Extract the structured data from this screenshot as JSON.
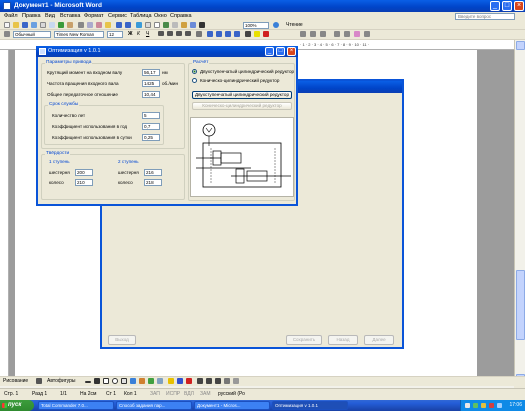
{
  "word": {
    "title": "Документ1 - Microsoft Word",
    "menu": [
      "Файл",
      "Правка",
      "Вид",
      "Вставка",
      "Формат",
      "Сервис",
      "Таблица",
      "Окно",
      "Справка"
    ],
    "help_placeholder": "Введите вопрос",
    "style_value": "Обычный",
    "font_value": "Times New Roman",
    "size_value": "12",
    "zoom_value": "100%",
    "read_label": "Чтение",
    "draw_label": "Рисование",
    "autoshapes_label": "Автофигуры",
    "status": [
      "Стр. 1",
      "Разд 1",
      "1/1",
      "На 2см",
      "Ст 1",
      "Кол 1",
      "ЗАП",
      "ИСПР",
      "ВДЛ",
      "ЗАМ",
      "русский (Ро"
    ]
  },
  "dialog": {
    "title": "Оптимизация v 1.0.1",
    "params_group": "Параметры привода",
    "torque_label": "Крутящий момент на входном валу",
    "torque_value": "56,17",
    "torque_unit": "нм",
    "speed_label": "Частота вращения входного вала",
    "speed_value": "1425",
    "speed_unit": "об./мин",
    "ratio_label": "Общее передаточное отношение",
    "ratio_value": "10,44",
    "service_group": "Срок службы",
    "years_label": "Количество лет",
    "years_value": "5",
    "kgod_label": "Коэффициент использования в год",
    "kgod_value": "0,7",
    "ksut_label": "Коэффициент использования в сутки",
    "ksut_value": "0,25",
    "hardness_group": "Твёрдости",
    "stage1_label": "1 ступень",
    "stage2_label": "2 ступень",
    "gear_label": "шестерня",
    "wheel_label": "колесо",
    "s1_gear": "200",
    "s1_wheel": "210",
    "s2_gear": "216",
    "s2_wheel": "218",
    "calc_group": "Расчёт",
    "radio1_label": "Двухступенчатый цилиндрический редуктор",
    "radio2_label": "Коническо-цилиндрический редуктор",
    "btn1_label": "Двухступенчатый цилиндрический редуктор",
    "btn2_label": "Коническо-цилиндрический редуктор"
  },
  "background_dialog": {
    "title": "",
    "back_label": "Назад",
    "next_label": "Далее",
    "cancel_label": "Выход",
    "save_label": "Сохранить"
  },
  "taskbar": {
    "start_label": "пуск",
    "tasks": [
      "Total Commander 7.0...",
      "Способ задания пар...",
      "Документ1 - Micros...",
      "Оптимизация v 1.0.1"
    ],
    "clock": "17:06"
  },
  "colors": {
    "accent": "#0a54d8",
    "taskbar": "#245dd7",
    "start": "#3c9d3c",
    "group_label": "#0046d5"
  }
}
